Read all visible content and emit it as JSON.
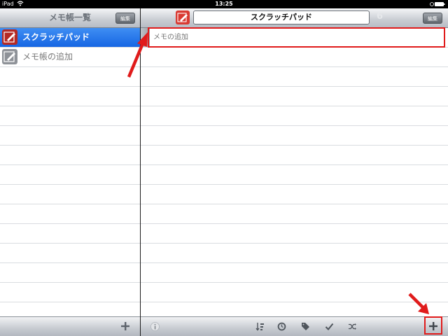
{
  "statusbar": {
    "device": "iPad",
    "time": "13:25"
  },
  "left": {
    "title": "メモ帳一覧",
    "edit_label": "編集",
    "items": [
      {
        "label": "スクラッチパッド",
        "selected": true
      },
      {
        "label": "メモ帳の追加",
        "selected": false
      }
    ]
  },
  "right": {
    "title": "スクラッチパッド",
    "count": "6",
    "edit_label": "編集",
    "add_memo_placeholder": "メモの追加"
  },
  "colors": {
    "selected_row": "#1f6fe8",
    "highlight": "#e01b1b",
    "notebook_icon_red": "#c8312b"
  }
}
